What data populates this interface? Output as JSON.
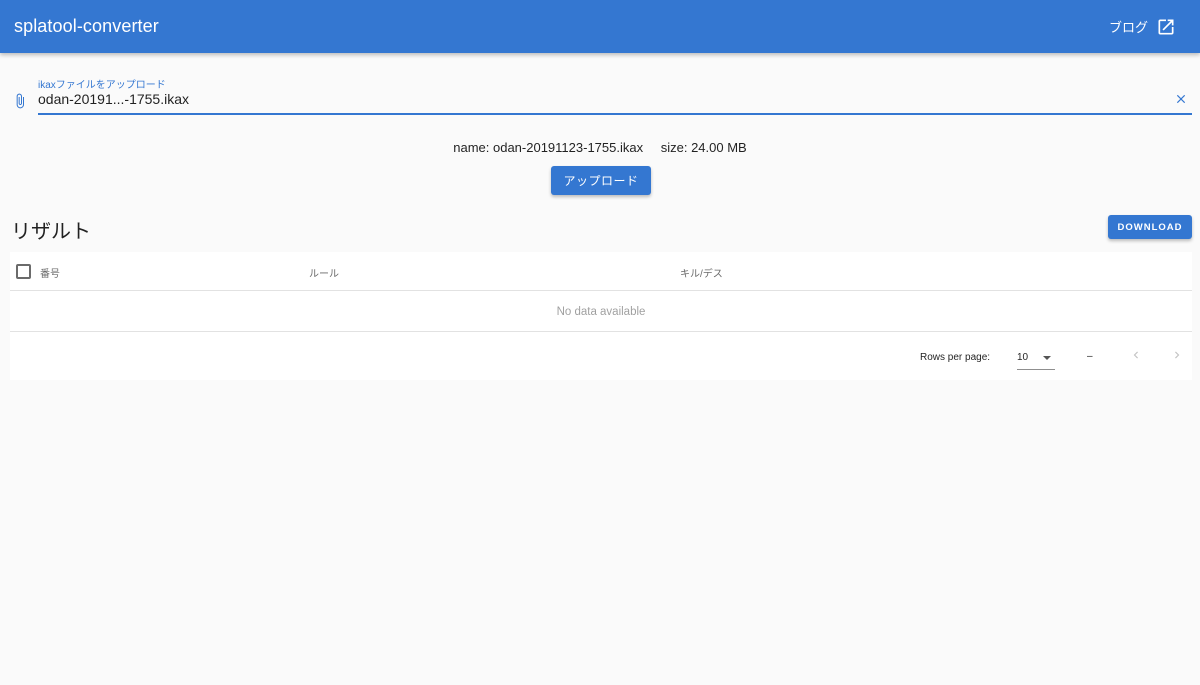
{
  "header": {
    "title": "splatool-converter",
    "blog_label": "ブログ",
    "blog_icon": "open-in-new-icon"
  },
  "upload_field": {
    "label": "ikaxファイルをアップロード",
    "value": "odan-20191...-1755.ikax",
    "prepend_icon": "paperclip-icon",
    "clear_icon": "close-icon"
  },
  "file_info": {
    "name_text": "name: odan-20191123-1755.ikax",
    "size_text": "size: 24.00 MB"
  },
  "upload_button": {
    "label": "アップロード"
  },
  "results": {
    "title": "リザルト",
    "download_label": "DOWNLOAD",
    "columns": [
      "番号",
      "ルール",
      "キル/デス"
    ],
    "empty_text": "No data available",
    "rows_per_page_label": "Rows per page:",
    "rows_per_page_value": "10",
    "page_text": "–"
  },
  "colors": {
    "primary": "#3477d1",
    "background": "#fafafa"
  }
}
